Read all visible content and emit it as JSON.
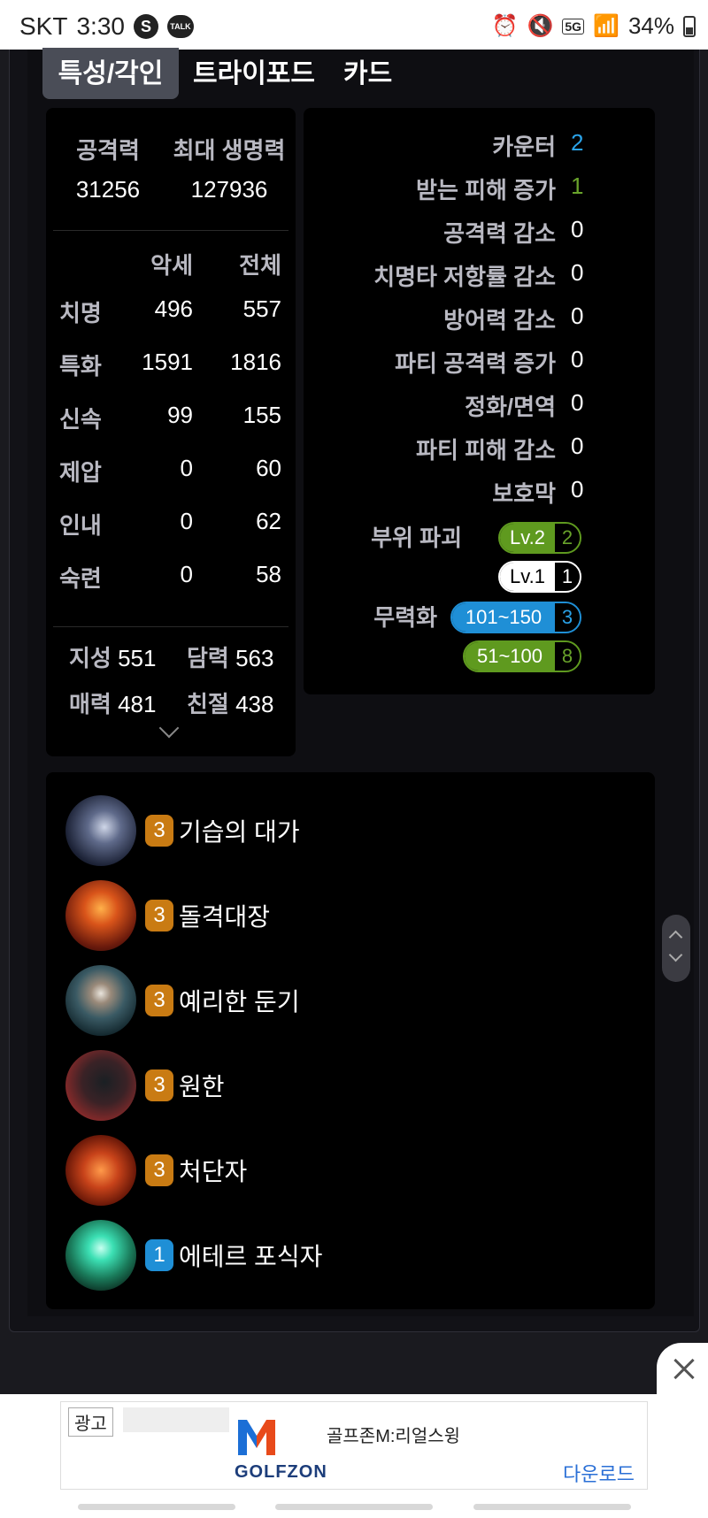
{
  "status_bar": {
    "carrier": "SKT",
    "time": "3:30",
    "s_app": "S",
    "talk_app": "TALK",
    "network": "5G",
    "battery": "34%"
  },
  "tabs": [
    "특성/각인",
    "트라이포드",
    "카드"
  ],
  "stats": {
    "attack_label": "공격력",
    "attack_value": "31256",
    "hp_label": "최대 생명력",
    "hp_value": "127936",
    "col_accessory": "악세",
    "col_total": "전체",
    "combat": [
      {
        "name": "치명",
        "acc": "496",
        "total": "557"
      },
      {
        "name": "특화",
        "acc": "1591",
        "total": "1816"
      },
      {
        "name": "신속",
        "acc": "99",
        "total": "155"
      },
      {
        "name": "제압",
        "acc": "0",
        "total": "60"
      },
      {
        "name": "인내",
        "acc": "0",
        "total": "62"
      },
      {
        "name": "숙련",
        "acc": "0",
        "total": "58"
      }
    ],
    "basic": [
      {
        "name": "지성",
        "value": "551"
      },
      {
        "name": "담력",
        "value": "563"
      },
      {
        "name": "매력",
        "value": "481"
      },
      {
        "name": "친절",
        "value": "438"
      }
    ]
  },
  "effects": [
    {
      "name": "카운터",
      "value": "2",
      "color": "#2aa2e8"
    },
    {
      "name": "받는 피해 증가",
      "value": "1",
      "color": "#69a32b"
    },
    {
      "name": "공격력 감소",
      "value": "0",
      "color": "#ffffff"
    },
    {
      "name": "치명타 저항률 감소",
      "value": "0",
      "color": "#ffffff"
    },
    {
      "name": "방어력 감소",
      "value": "0",
      "color": "#ffffff"
    },
    {
      "name": "파티 공격력 증가",
      "value": "0",
      "color": "#ffffff"
    },
    {
      "name": "정화/면역",
      "value": "0",
      "color": "#ffffff"
    },
    {
      "name": "파티 피해 감소",
      "value": "0",
      "color": "#ffffff"
    },
    {
      "name": "보호막",
      "value": "0",
      "color": "#ffffff"
    }
  ],
  "part_break": {
    "label": "부위 파괴",
    "levels": [
      {
        "label": "Lv.2",
        "count": "2",
        "color": "#5f9a1f",
        "text_color": "#ffffff"
      },
      {
        "label": "Lv.1",
        "count": "1",
        "color": "#ffffff",
        "text_color": "#000000"
      }
    ]
  },
  "stagger": {
    "label": "무력화",
    "levels": [
      {
        "label": "101~150",
        "count": "3",
        "color": "#1f8fd6"
      },
      {
        "label": "51~100",
        "count": "8",
        "color": "#5f9a1f"
      }
    ]
  },
  "engravings": [
    {
      "level": "3",
      "name": "기습의 대가",
      "icon": "hooded-figure-icon",
      "badge_color": "#c97b13"
    },
    {
      "level": "3",
      "name": "돌격대장",
      "icon": "charging-warriors-icon",
      "badge_color": "#c97b13"
    },
    {
      "level": "3",
      "name": "예리한 둔기",
      "icon": "spiked-mace-icon",
      "badge_color": "#c97b13"
    },
    {
      "level": "3",
      "name": "원한",
      "icon": "howling-wolf-icon",
      "badge_color": "#c97b13"
    },
    {
      "level": "3",
      "name": "처단자",
      "icon": "cleaver-icon",
      "badge_color": "#c97b13"
    },
    {
      "level": "1",
      "name": "에테르 포식자",
      "icon": "ether-orb-icon",
      "badge_color": "#1f8fd6"
    }
  ],
  "ad": {
    "label": "광고",
    "brand": "GOLFZON",
    "title": "골프존M:리얼스윙",
    "cta": "다운로드"
  }
}
